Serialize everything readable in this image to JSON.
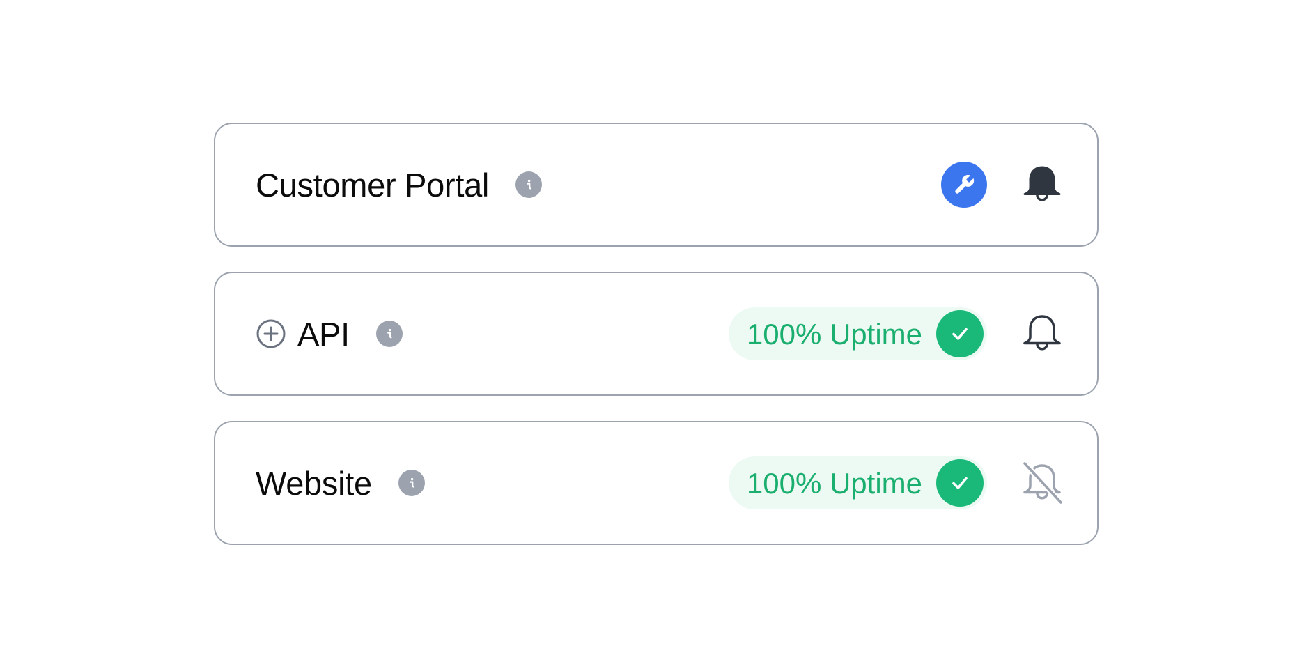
{
  "services": [
    {
      "name": "Customer Portal",
      "expand_icon": null,
      "info_icon": "info-icon",
      "status": "maintenance",
      "status_icon": "wrench-icon",
      "uptime_label": null,
      "notifications": "on",
      "bell_icon": "bell-filled-icon"
    },
    {
      "name": "API",
      "expand_icon": "plus-circle-icon",
      "info_icon": "info-icon",
      "status": "operational",
      "status_icon": "check-icon",
      "uptime_label": "100% Uptime",
      "notifications": "on",
      "bell_icon": "bell-outline-icon"
    },
    {
      "name": "Website",
      "expand_icon": null,
      "info_icon": "info-icon",
      "status": "operational",
      "status_icon": "check-icon",
      "uptime_label": "100% Uptime",
      "notifications": "off",
      "bell_icon": "bell-off-icon"
    }
  ],
  "colors": {
    "card_border": "#9ca3af",
    "info_badge": "#9ca3af",
    "maintenance": "#3b76ee",
    "uptime_text": "#1aae6f",
    "uptime_bg": "#ecfaf3",
    "check_bg": "#1ab97a",
    "bell_active": "#2f3640",
    "bell_muted": "#9ca3af"
  }
}
